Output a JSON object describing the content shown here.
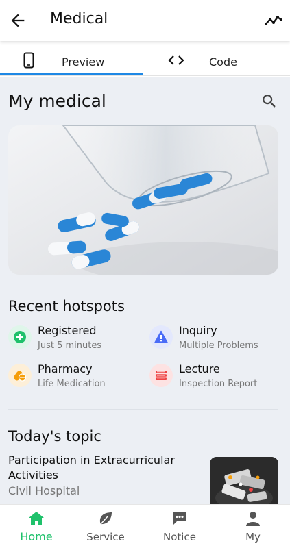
{
  "appbar": {
    "title": "Medical",
    "back_icon": "arrow-left-icon",
    "action_icon": "trending-icon"
  },
  "tabs": [
    {
      "label": "Preview",
      "icon": "phone-icon",
      "selected": true
    },
    {
      "label": "Code",
      "icon": "code-icon",
      "selected": false
    }
  ],
  "main": {
    "title": "My medical",
    "search_icon": "search-icon"
  },
  "hotspots": {
    "title": "Recent hotspots",
    "items": [
      {
        "name": "Registered",
        "sub": "Just 5 minutes",
        "icon": "plus-circle-icon",
        "color": "#1fc16b"
      },
      {
        "name": "Inquiry",
        "sub": "Multiple Problems",
        "icon": "warning-icon",
        "color": "#4a6cf7"
      },
      {
        "name": "Pharmacy",
        "sub": "Life Medication",
        "icon": "pills-icon",
        "color": "#f59e0b"
      },
      {
        "name": "Lecture",
        "sub": "Inspection Report",
        "icon": "layers-icon",
        "color": "#ef4444"
      }
    ]
  },
  "topic": {
    "title": "Today's topic",
    "headline": "Participation in Extracurricular Activities",
    "source": "Civil Hospital"
  },
  "bottomnav": [
    {
      "label": "Home",
      "icon": "home-icon",
      "active": true
    },
    {
      "label": "Service",
      "icon": "leaf-icon",
      "active": false
    },
    {
      "label": "Notice",
      "icon": "chat-icon",
      "active": false
    },
    {
      "label": "My",
      "icon": "person-icon",
      "active": false
    }
  ],
  "colors": {
    "accent": "#1fc16b",
    "tab_indicator": "#1e88e5",
    "background": "#eceff4"
  }
}
